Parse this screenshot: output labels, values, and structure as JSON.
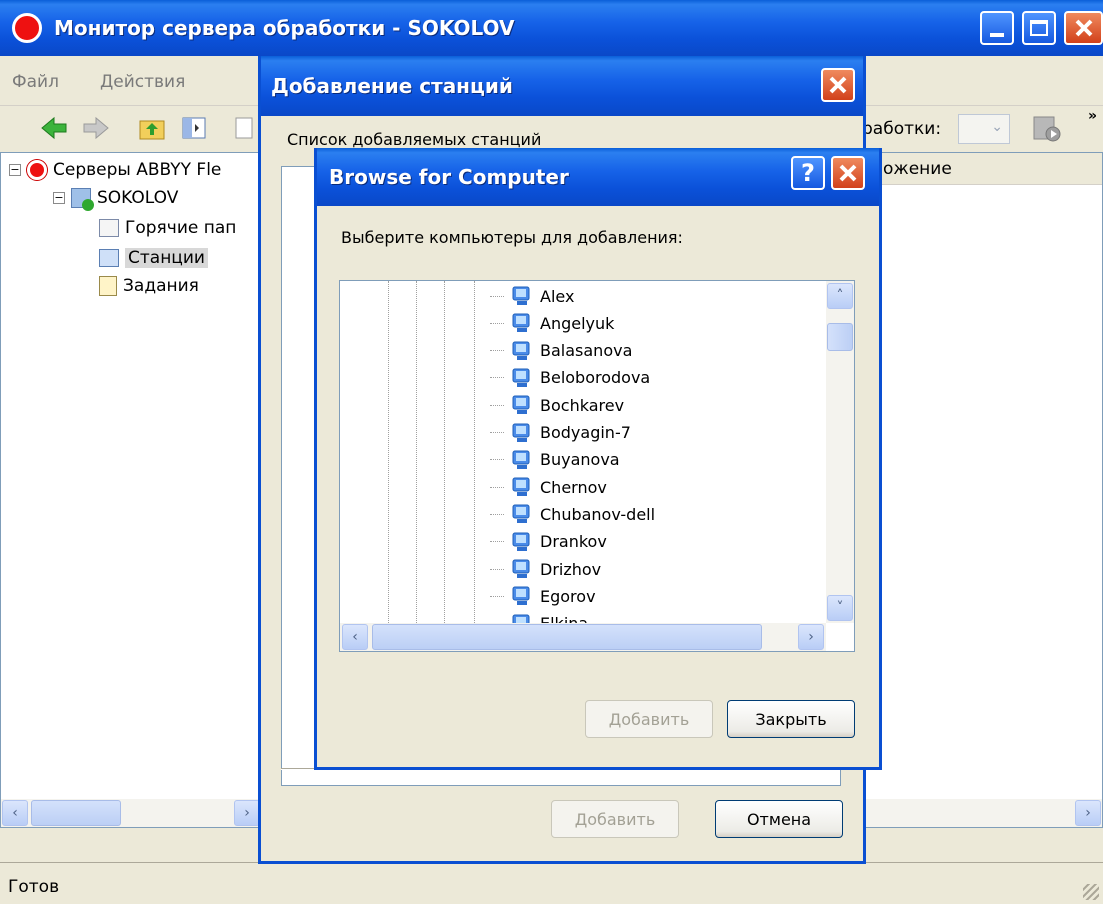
{
  "main_window": {
    "title": "Монитор сервера обработки - SOKOLOV",
    "menu": [
      "Файл",
      "Действия"
    ],
    "toolbar": {
      "partial_label": "работки:"
    },
    "tree": {
      "root": "Серверы ABBYY Fle",
      "server": "SOKOLOV",
      "items": [
        "Горячие пап",
        "Станции",
        "Задания"
      ]
    },
    "column_header": "ожение",
    "status": "Готов"
  },
  "add_dialog": {
    "title": "Добавление станций",
    "list_label": "Список добавляемых станций",
    "add_button": "Добавить",
    "cancel_button": "Отмена"
  },
  "browse_dialog": {
    "title": "Browse for Computer",
    "help_glyph": "?",
    "prompt": "Выберите компьютеры для добавления:",
    "computers": [
      "Alex",
      "Angelyuk",
      "Balasanova",
      "Beloborodova",
      "Bochkarev",
      "Bodyagin-7",
      "Buyanova",
      "Chernov",
      "Chubanov-dell",
      "Drankov",
      "Drizhov",
      "Egorov",
      "Elkina"
    ],
    "add_button": "Добавить",
    "close_button": "Закрыть"
  },
  "colors": {
    "titlebar": "#0b51d9",
    "close": "#d2411b",
    "face": "#ece9d8"
  }
}
